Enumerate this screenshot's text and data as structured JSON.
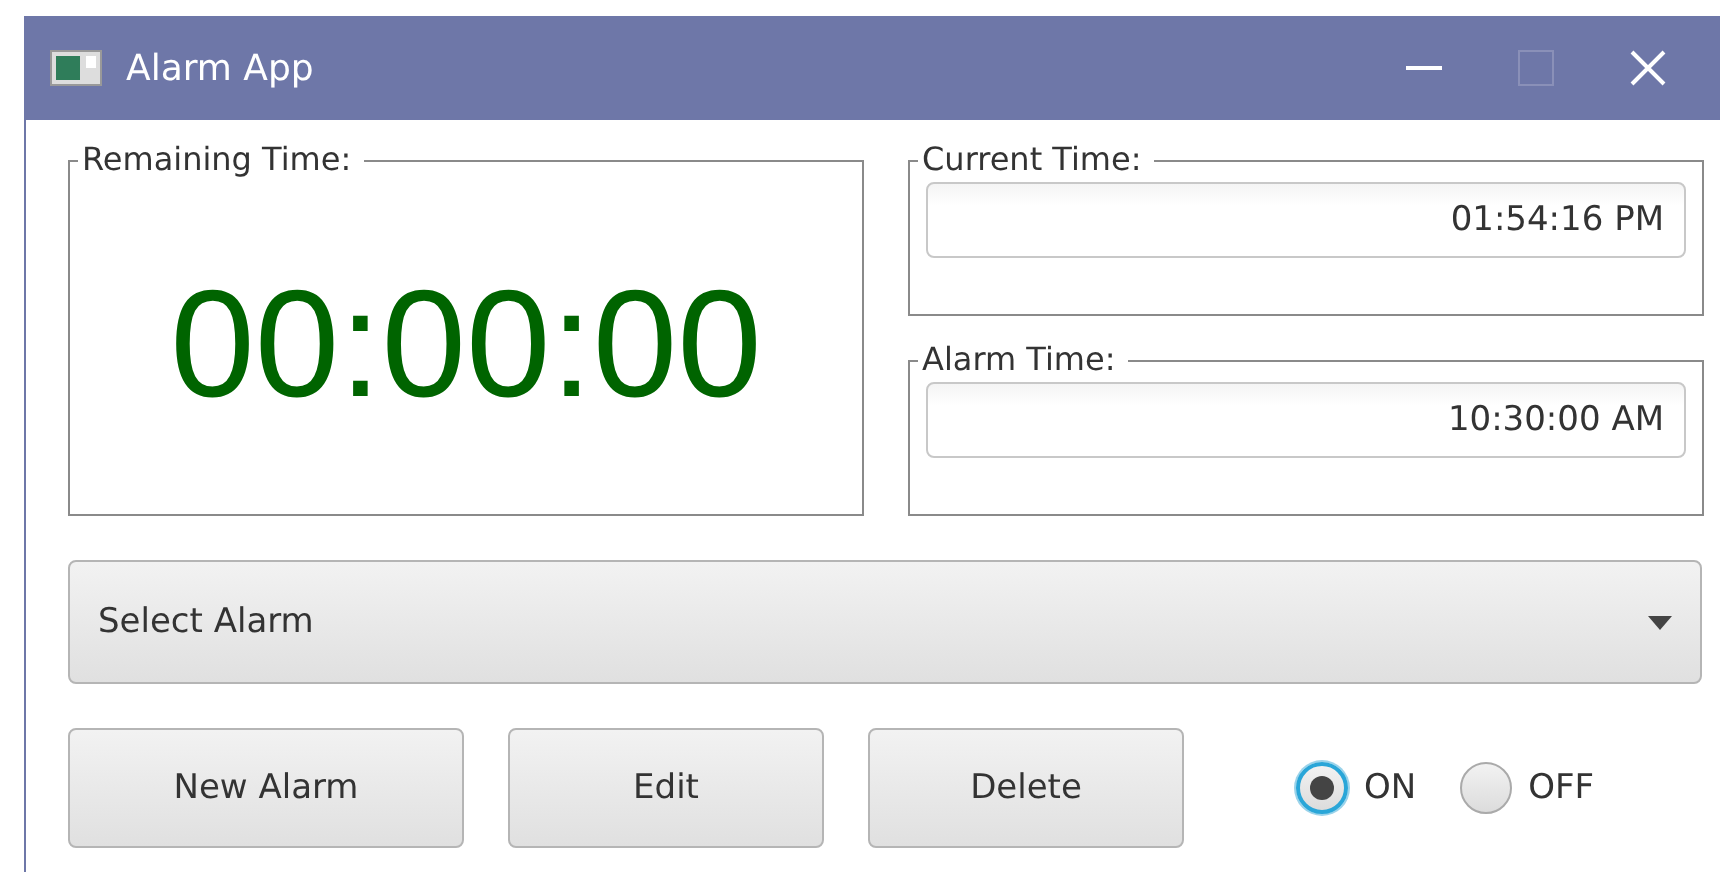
{
  "window": {
    "title": "Alarm App"
  },
  "remaining": {
    "label": "Remaining Time:",
    "value": "00:00:00"
  },
  "current_time": {
    "label": "Current Time:",
    "value": "01:54:16 PM"
  },
  "alarm_time": {
    "label": "Alarm Time:",
    "value": "10:30:00 AM"
  },
  "alarm_select": {
    "placeholder": "Select Alarm"
  },
  "buttons": [
    "New Alarm",
    "Edit",
    "Delete"
  ],
  "radios": [
    {
      "label": "ON",
      "selected": true
    },
    {
      "label": "OFF",
      "selected": false
    }
  ]
}
